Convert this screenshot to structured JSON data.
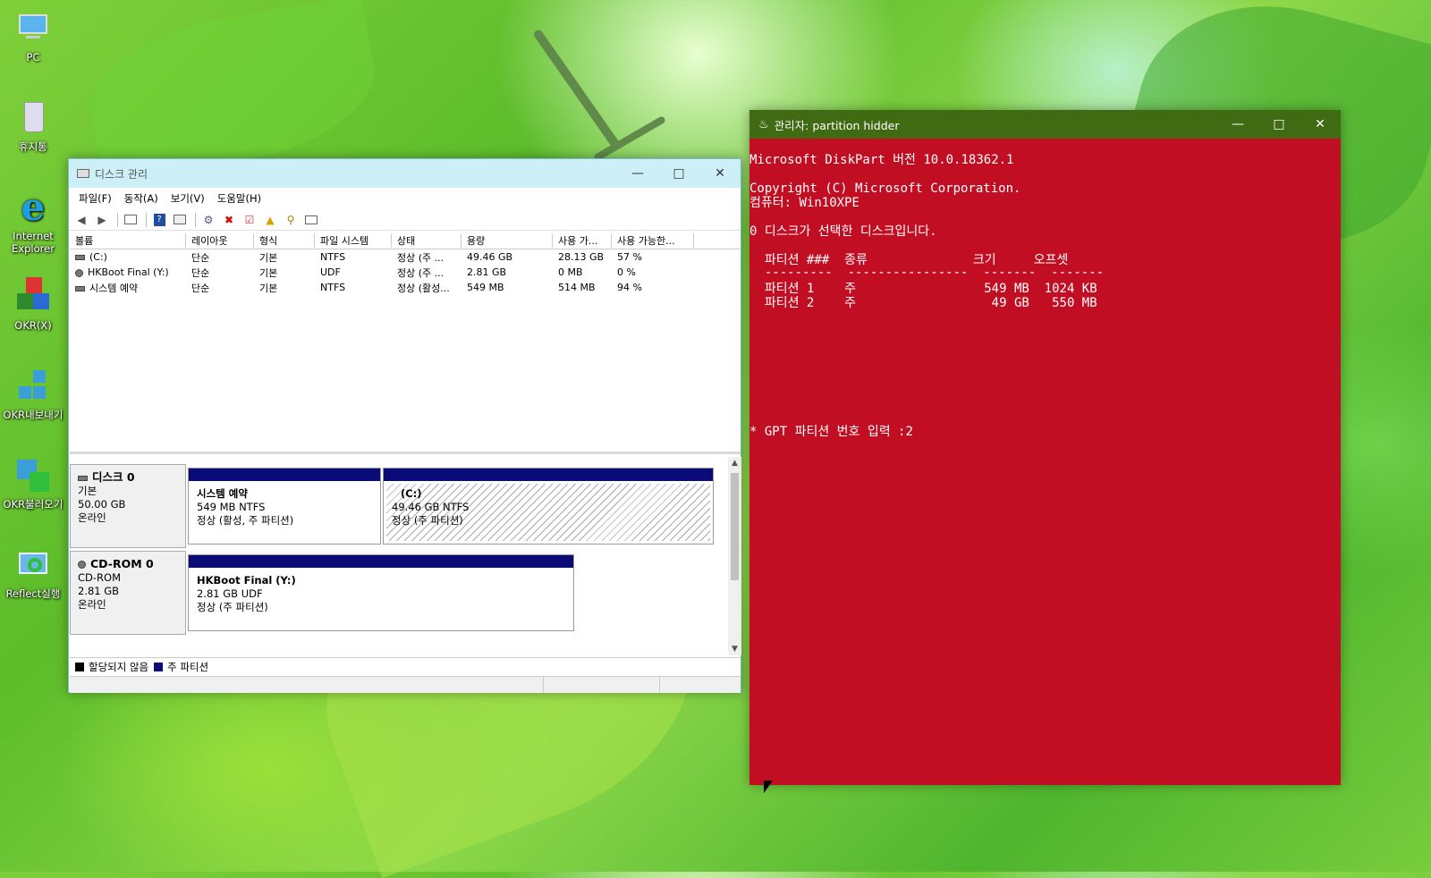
{
  "desktop": {
    "icons": [
      {
        "label": "PC",
        "icon": "monitor-icon"
      },
      {
        "label": "휴지통",
        "icon": "recycle-bin-icon"
      },
      {
        "label": "Internet Explorer",
        "icon": "internet-explorer-icon"
      },
      {
        "label": "OKR(X)",
        "icon": "okr-cube-icon"
      },
      {
        "label": "OKR내보내기",
        "icon": "okr-export-icon"
      },
      {
        "label": "OKR불러오기",
        "icon": "okr-import-icon"
      },
      {
        "label": "Reflect실행",
        "icon": "reflect-icon"
      }
    ]
  },
  "disk_mgmt": {
    "title": "디스크 관리",
    "menu": [
      "파일(F)",
      "동작(A)",
      "보기(V)",
      "도움말(H)"
    ],
    "columns": [
      "볼륨",
      "레이아웃",
      "형식",
      "파일 시스템",
      "상태",
      "용량",
      "사용 가...",
      "사용 가능한..."
    ],
    "volumes": [
      {
        "name": "(C:)",
        "layout": "단순",
        "type": "기본",
        "fs": "NTFS",
        "status": "정상 (주 ...",
        "capacity": "49.46 GB",
        "free": "28.13 GB",
        "pct": "57 %"
      },
      {
        "name": "HKBoot Final (Y:)",
        "layout": "단순",
        "type": "기본",
        "fs": "UDF",
        "status": "정상 (주 ...",
        "capacity": "2.81 GB",
        "free": "0 MB",
        "pct": "0 %"
      },
      {
        "name": "시스템 예약",
        "layout": "단순",
        "type": "기본",
        "fs": "NTFS",
        "status": "정상 (활성...",
        "capacity": "549 MB",
        "free": "514 MB",
        "pct": "94 %"
      }
    ],
    "disk0": {
      "name": "디스크 0",
      "kind": "기본",
      "size": "50.00 GB",
      "state": "온라인",
      "p1": {
        "name": "시스템 예약",
        "info": "549 MB NTFS",
        "status": "정상 (활성, 주 파티션)"
      },
      "p2": {
        "name": "(C:)",
        "info": "49.46 GB NTFS",
        "status": "정상 (주 파티션)"
      }
    },
    "cdrom0": {
      "name": "CD-ROM 0",
      "kind": "CD-ROM",
      "size": "2.81 GB",
      "state": "온라인",
      "p1": {
        "name": "HKBoot Final  (Y:)",
        "info": "2.81 GB UDF",
        "status": "정상 (주 파티션)"
      }
    },
    "legend": {
      "unallocated": "할당되지 않음",
      "primary": "주 파티션"
    },
    "colors": {
      "primary": "#0a0a78",
      "unallocated": "#000000"
    }
  },
  "console": {
    "title": "관리자:  partition hidder",
    "lines": [
      "Microsoft DiskPart 버전 10.0.18362.1",
      "Copyright (C) Microsoft Corporation.",
      "컴퓨터: Win10XPE",
      "0 디스크가 선택한 디스크입니다.",
      "  파티션 ###  종류              크기     오프셋",
      "  ---------  ----------------  -------  -------",
      "  파티션 1    주                 549 MB  1024 KB",
      "  파티션 2    주                  49 GB   550 MB",
      "* GPT 파티션 번호 입력 :2"
    ],
    "bg_color": "#c20e22",
    "title_color": "#416b12"
  }
}
